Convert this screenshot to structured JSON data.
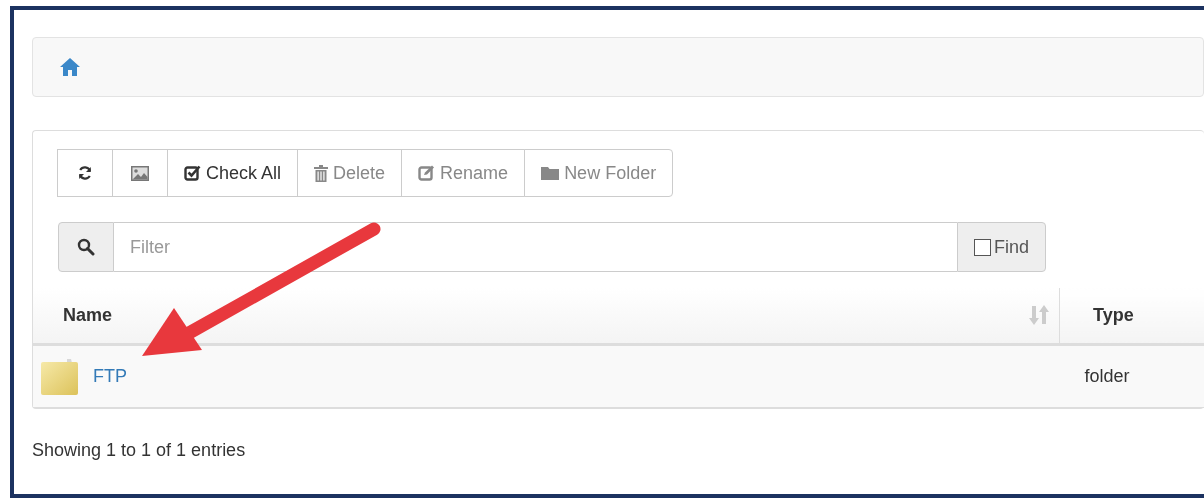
{
  "breadcrumb": {
    "items": [
      {
        "kind": "home"
      }
    ]
  },
  "toolbar": [
    {
      "kind": "refresh",
      "disabled": false
    },
    {
      "kind": "image",
      "disabled": false
    },
    {
      "kind": "check",
      "label": "Check All",
      "disabled": false
    },
    {
      "kind": "trash",
      "label": "Delete",
      "disabled": true
    },
    {
      "kind": "edit",
      "label": "Rename",
      "disabled": true
    },
    {
      "kind": "folder",
      "label": "New Folder",
      "disabled": true
    }
  ],
  "filter": {
    "placeholder": "Filter",
    "find": {
      "label": "Find",
      "checked": false
    }
  },
  "table": {
    "columns": [
      {
        "label": "Name",
        "sortable": true
      },
      {
        "label": "Type",
        "sortable": false
      }
    ],
    "rows": [
      {
        "name": "FTP",
        "type": "folder"
      }
    ]
  },
  "footer": "Showing 1 to 1 of 1 entries"
}
